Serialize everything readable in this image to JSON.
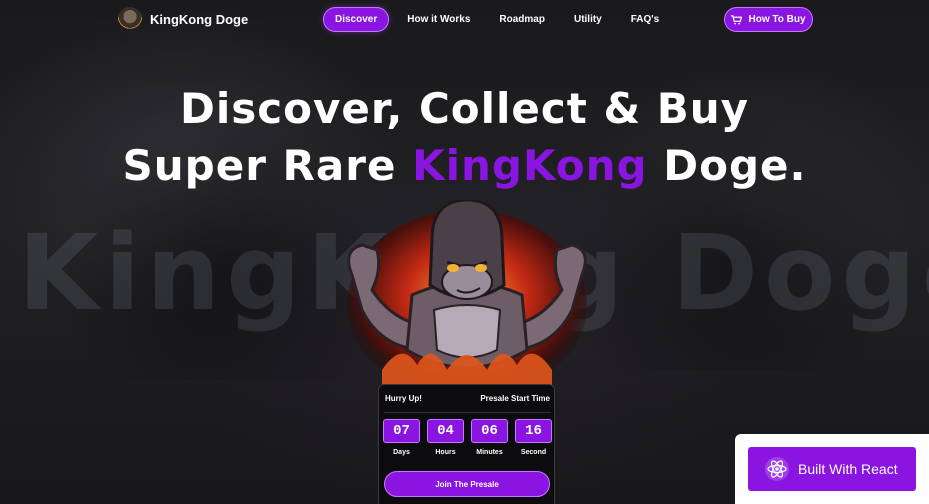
{
  "brand": {
    "name": "KingKong Doge"
  },
  "nav": {
    "items": [
      {
        "label": "Discover",
        "active": true
      },
      {
        "label": "How it Works",
        "active": false
      },
      {
        "label": "Roadmap",
        "active": false
      },
      {
        "label": "Utility",
        "active": false
      },
      {
        "label": "FAQ's",
        "active": false
      }
    ],
    "cta": {
      "label": "How To Buy",
      "icon": "cart-icon"
    }
  },
  "hero": {
    "line1": "Discover, Collect & Buy",
    "line2_prefix": "Super Rare ",
    "line2_accent": "KingKong",
    "line2_suffix": " Doge.",
    "watermark": "KingKong Doge"
  },
  "countdown": {
    "title": "Hurry Up!",
    "subtitle": "Presale Start Time",
    "units": [
      {
        "value": "07",
        "label": "Days"
      },
      {
        "value": "04",
        "label": "Hours"
      },
      {
        "value": "06",
        "label": "Minutes"
      },
      {
        "value": "16",
        "label": "Second"
      }
    ],
    "button": "Join The Presale"
  },
  "badge": {
    "label": "Built With React",
    "icon": "react-icon"
  },
  "colors": {
    "accent": "#8a14e0",
    "accent_border": "#c27bff",
    "background": "#1a1a1d",
    "badge_bg": "#ffffff"
  }
}
